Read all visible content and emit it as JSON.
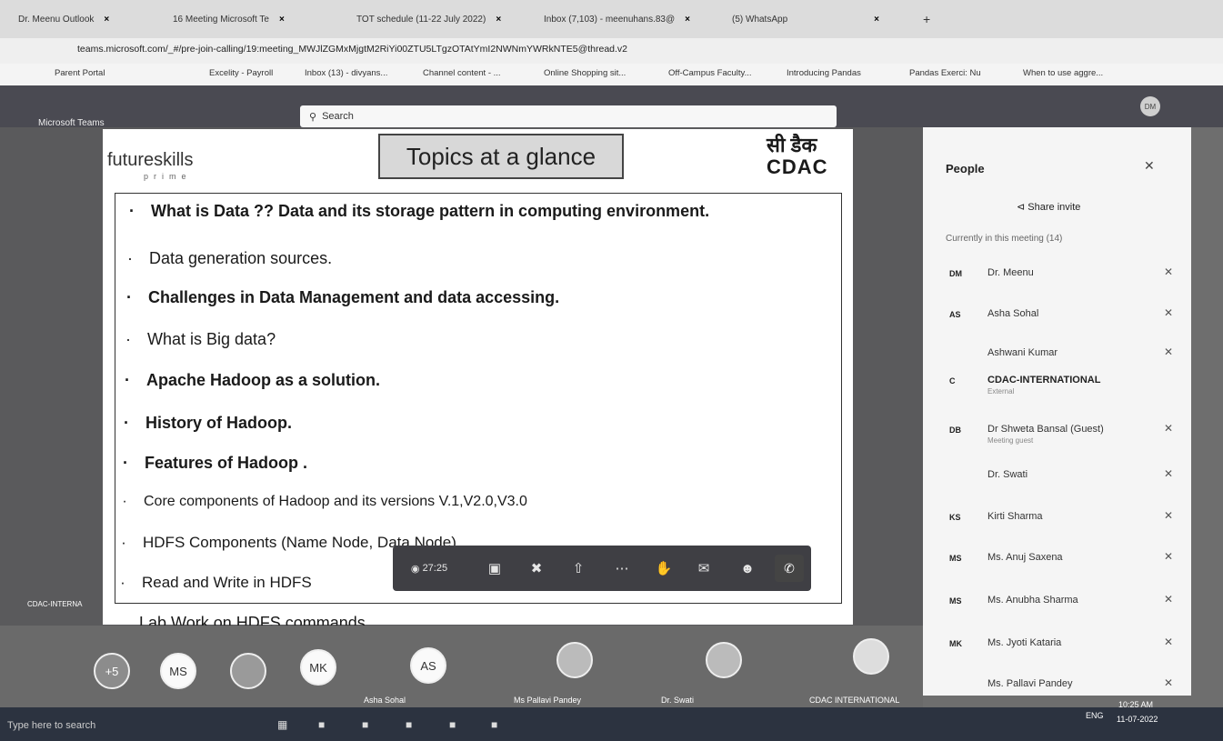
{
  "browser": {
    "tabs": [
      {
        "label": "Dr. Meenu Outlook",
        "close": "×"
      },
      {
        "label": "16 Meeting Microsoft Te",
        "close": "×"
      },
      {
        "label": "TOT schedule (11-22 July 2022)",
        "close": "×"
      },
      {
        "label": "Inbox (7,103) - meenuhans.83@",
        "close": "×"
      },
      {
        "label": "(5) WhatsApp",
        "close": "×"
      }
    ],
    "new_tab": "+",
    "url": "teams.microsoft.com/_#/pre-join-calling/19:meeting_MWJlZGMxMjgtM2RiYi00ZTU5LTgzOTAtYmI2NWNmYWRkNTE5@thread.v2",
    "bookmarks": [
      "Parent Portal",
      "Excelity - Payroll",
      "Inbox (13) - divyans...",
      "Channel content - ...",
      "Online Shopping sit...",
      "Off-Campus Faculty...",
      "Introducing Pandas",
      "Pandas Exerci: Nu",
      "When to use aggre..."
    ]
  },
  "teams": {
    "app_title": "Microsoft Teams",
    "search_placeholder": "Search",
    "me_initials": "DM"
  },
  "slide": {
    "brand": "futureskills",
    "brand_sub": "prime",
    "title": "Topics at a glance",
    "partner_hi": "सी डैक",
    "partner_logo": "CDAC",
    "topics": [
      "What is Data ?? Data and its storage pattern in computing environment.",
      "Data generation sources.",
      "Challenges in Data Management and data accessing.",
      "What is Big data?",
      "Apache Hadoop as a solution.",
      "History of Hadoop.",
      "Features of Hadoop .",
      "Core components of Hadoop and its versions V.1,V2.0,V3.0",
      "HDFS Components (Name Node, Data Node)",
      "Read and Write in HDFS"
    ],
    "lab_line": "Lab Work on HDFS commands"
  },
  "controls": {
    "timer": "27:25"
  },
  "thumbs": {
    "overflow": "+5",
    "circles": [
      "MS",
      "MK",
      "AS"
    ],
    "labels": [
      "Asha Sohal",
      "Ms Pallavi Pandey",
      "Dr. Swati",
      "CDAC INTERNATIONAL"
    ],
    "left_tile_label": "CDAC-INTERNA"
  },
  "people": {
    "title": "People",
    "share_invite": "Share invite",
    "current_header": "Currently in this meeting (14)",
    "rows": [
      {
        "initials": "DM",
        "name": "Dr. Meenu",
        "sub": ""
      },
      {
        "initials": "AS",
        "name": "Asha Sohal",
        "sub": ""
      },
      {
        "initials": "",
        "name": "Ashwani Kumar",
        "sub": ""
      },
      {
        "initials": "C",
        "name": "CDAC-INTERNATIONAL",
        "sub": "External"
      },
      {
        "initials": "DB",
        "name": "Dr Shweta Bansal (Guest)",
        "sub": "Meeting guest"
      },
      {
        "initials": "",
        "name": "Dr. Swati",
        "sub": ""
      },
      {
        "initials": "KS",
        "name": "Kirti Sharma",
        "sub": ""
      },
      {
        "initials": "MS",
        "name": "Ms. Anuj Saxena",
        "sub": ""
      },
      {
        "initials": "MS",
        "name": "Ms. Anubha Sharma",
        "sub": ""
      },
      {
        "initials": "MK",
        "name": "Ms. Jyoti Kataria",
        "sub": ""
      },
      {
        "initials": "",
        "name": "Ms. Pallavi Pandey",
        "sub": ""
      }
    ]
  },
  "taskbar": {
    "search_placeholder": "Type here to search",
    "lang": "ENG",
    "time": "10:25 AM",
    "date": "11-07-2022"
  },
  "colors": {
    "teams_bar": "#4a4a52",
    "panel": "#f5f5f5",
    "taskbar": "#2c3340"
  }
}
